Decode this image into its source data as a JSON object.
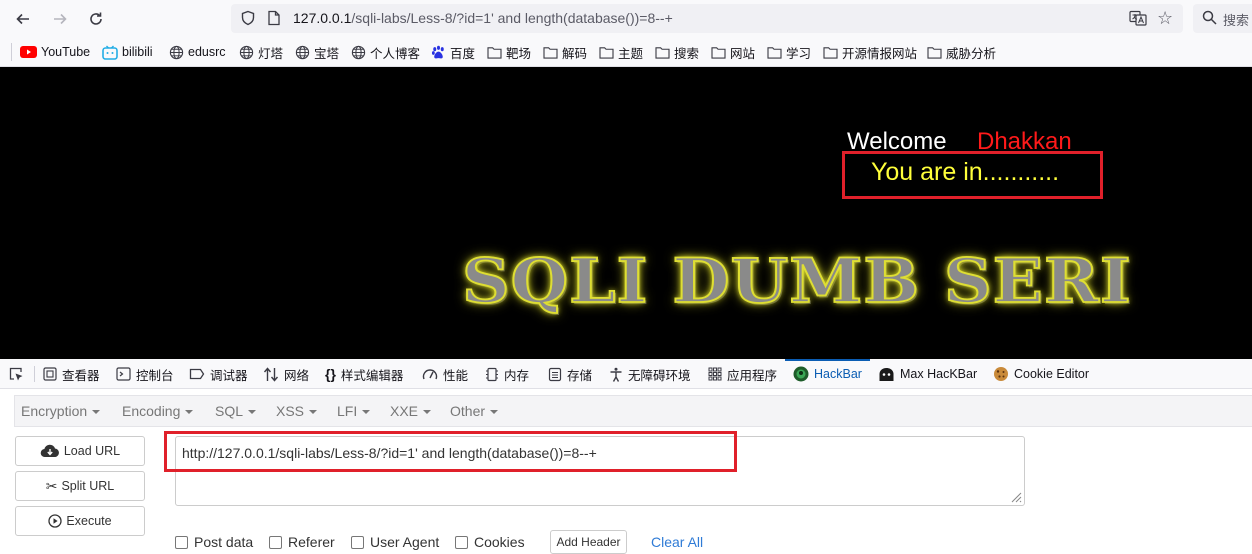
{
  "browser": {
    "url": {
      "host": "127.0.0.1",
      "path": "/sqli-labs/Less-8/?id=1' and length(database())=8--+"
    },
    "search_label": "搜索",
    "icons": {
      "back": "arrow-left-icon",
      "forward": "arrow-right-icon",
      "reload": "reload-icon",
      "shield": "shield-icon",
      "page": "page-icon",
      "translate": "translate-icon",
      "star": "star-icon",
      "search": "search-icon"
    }
  },
  "bookmarks": [
    {
      "label": "YouTube",
      "icon": "youtube-icon"
    },
    {
      "label": "bilibili",
      "icon": "bilibili-icon"
    },
    {
      "label": "edusrc",
      "icon": "globe-icon"
    },
    {
      "label": "灯塔",
      "icon": "globe-icon"
    },
    {
      "label": "宝塔",
      "icon": "globe-icon"
    },
    {
      "label": "个人博客",
      "icon": "globe-icon"
    },
    {
      "label": "百度",
      "icon": "baidu-icon"
    },
    {
      "label": "靶场",
      "icon": "folder-icon"
    },
    {
      "label": "解码",
      "icon": "folder-icon"
    },
    {
      "label": "主题",
      "icon": "folder-icon"
    },
    {
      "label": "搜索",
      "icon": "folder-icon"
    },
    {
      "label": "网站",
      "icon": "folder-icon"
    },
    {
      "label": "学习",
      "icon": "folder-icon"
    },
    {
      "label": "开源情报网站",
      "icon": "folder-icon"
    },
    {
      "label": "威胁分析",
      "icon": "folder-icon"
    }
  ],
  "page": {
    "welcome": "Welcome",
    "username": "Dhakkan",
    "result": "You are in...........",
    "banner": "SQLI DUMB SERI"
  },
  "devtools": {
    "tabs": [
      {
        "label": "查看器",
        "icon": "inspector-icon"
      },
      {
        "label": "控制台",
        "icon": "console-icon"
      },
      {
        "label": "调试器",
        "icon": "debugger-icon"
      },
      {
        "label": "网络",
        "icon": "network-icon"
      },
      {
        "label": "样式编辑器",
        "icon": "style-editor-icon"
      },
      {
        "label": "性能",
        "icon": "performance-icon"
      },
      {
        "label": "内存",
        "icon": "memory-icon"
      },
      {
        "label": "存储",
        "icon": "storage-icon"
      },
      {
        "label": "无障碍环境",
        "icon": "accessibility-icon"
      },
      {
        "label": "应用程序",
        "icon": "application-icon"
      },
      {
        "label": "HackBar",
        "icon": "hackbar-icon",
        "active": true
      },
      {
        "label": "Max HacKBar",
        "icon": "max-hackbar-icon"
      },
      {
        "label": "Cookie Editor",
        "icon": "cookie-icon"
      }
    ]
  },
  "hackbar": {
    "menus": [
      "Encryption",
      "Encoding",
      "SQL",
      "XSS",
      "LFI",
      "XXE",
      "Other"
    ],
    "buttons": {
      "load": "Load URL",
      "split": "Split URL",
      "execute": "Execute"
    },
    "url_value": "http://127.0.0.1/sqli-labs/Less-8/?id=1' and length(database())=8--+",
    "options": [
      "Post data",
      "Referer",
      "User Agent",
      "Cookies"
    ],
    "add_header": "Add Header",
    "clear_all": "Clear All"
  },
  "colors": {
    "highlight_red": "#e0202a",
    "active_tab": "#0b5db3",
    "result_yellow": "#ffff3a",
    "username_red": "#ff1a1a",
    "link_blue": "#2f7bd6"
  }
}
